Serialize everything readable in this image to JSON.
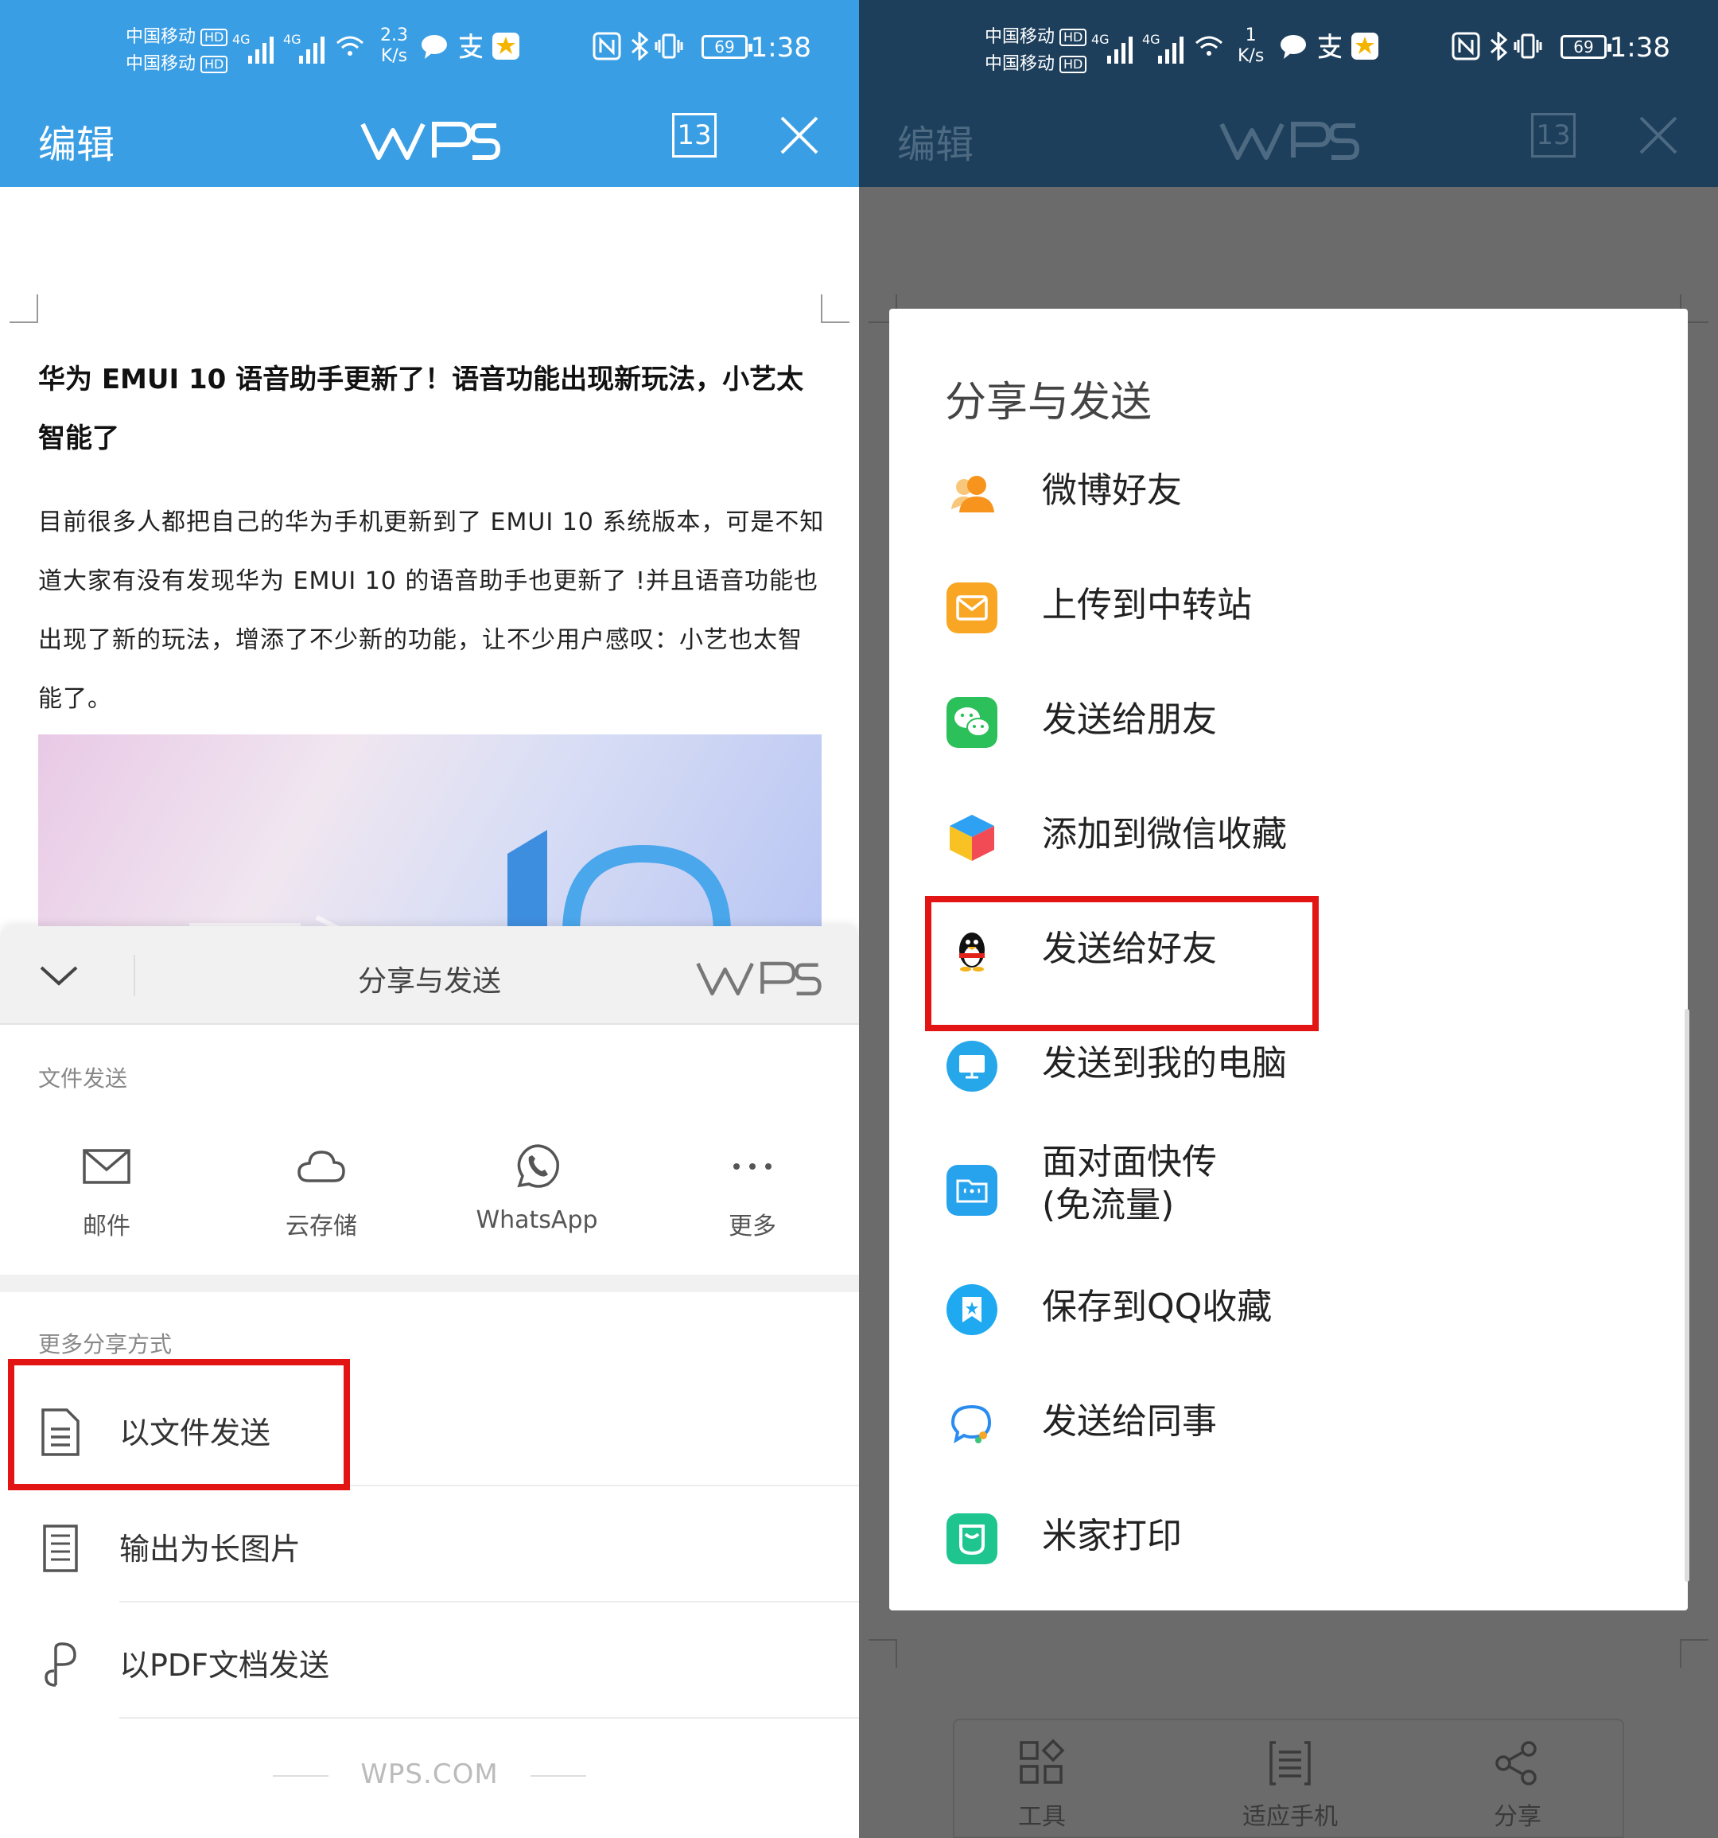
{
  "status_bar": {
    "carrier1": "中国移动",
    "carrier2": "中国移动",
    "hd": "HD",
    "net": "4G",
    "left_speed_value": "2.3",
    "right_speed_value": "1",
    "speed_unit": "K/s",
    "battery": "69",
    "time": "1:38"
  },
  "toolbar": {
    "edit_label": "编辑",
    "logo": "WPS",
    "tab_count": "13",
    "left_bg": "#3a9ee4",
    "right_bg": "#1d3f5c"
  },
  "document": {
    "title": "华为 EMUI 10 语音助手更新了！语音功能出现新玩法，小艺太智能了",
    "paragraph": "目前很多人都把自己的华为手机更新到了 EMUI 10 系统版本，可是不知道大家有没有发现华为 EMUI 10 的语音助手也更新了 !并且语音功能也出现了新的玩法，增添了不少新的功能，让不少用户感叹：小艺也太智能了。"
  },
  "share_sheet": {
    "title": "分享与发送",
    "file_send_label": "文件发送",
    "quick_items": [
      {
        "label": "邮件",
        "icon": "mail-icon"
      },
      {
        "label": "云存储",
        "icon": "cloud-icon"
      },
      {
        "label": "WhatsApp",
        "icon": "whatsapp-icon"
      },
      {
        "label": "更多",
        "icon": "more-dots-icon"
      }
    ],
    "more_label": "更多分享方式",
    "more_items": [
      {
        "label": "以文件发送",
        "icon": "document-icon"
      },
      {
        "label": "输出为长图片",
        "icon": "long-image-icon"
      },
      {
        "label": "以PDF文档发送",
        "icon": "pdf-icon"
      }
    ],
    "footer": "WPS.COM"
  },
  "share_dialog": {
    "title": "分享与发送",
    "options": [
      {
        "label": "微博好友",
        "icon": "weibo-friend-icon",
        "color": "#f7a21b"
      },
      {
        "label": "上传到中转站",
        "icon": "mail-transfer-icon",
        "color": "#f8a623"
      },
      {
        "label": "发送给朋友",
        "icon": "wechat-icon",
        "color": "#2cc05a"
      },
      {
        "label": "添加到微信收藏",
        "icon": "wechat-favorite-cube-icon",
        "color": "#f24b55"
      },
      {
        "label": "发送给好友",
        "icon": "qq-penguin-icon",
        "color": "#111111"
      },
      {
        "label": "发送到我的电脑",
        "icon": "my-computer-icon",
        "color": "#25a7ea"
      },
      {
        "label": "面对面快传",
        "label2": "(免流量)",
        "icon": "face-to-face-icon",
        "color": "#27a3ee"
      },
      {
        "label": "保存到QQ收藏",
        "icon": "qq-favorite-icon",
        "color": "#1fa9f0"
      },
      {
        "label": "发送给同事",
        "icon": "tim-chat-icon",
        "color": "#2b8cf0"
      },
      {
        "label": "米家打印",
        "icon": "mijia-print-icon",
        "color": "#1fc58e"
      }
    ]
  },
  "bottom_bar": {
    "items": [
      {
        "label": "工具",
        "icon": "tools-grid-icon"
      },
      {
        "label": "适应手机",
        "icon": "fit-phone-icon"
      },
      {
        "label": "分享",
        "icon": "share-icon"
      }
    ]
  },
  "highlight_color": "#e31414"
}
